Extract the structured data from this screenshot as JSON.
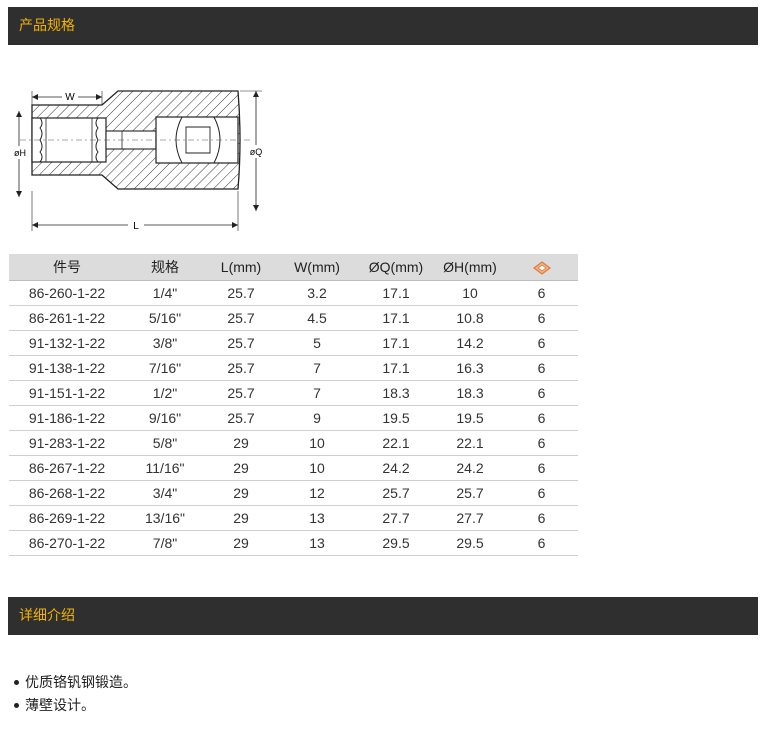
{
  "sections": {
    "specs_title": "产品规格",
    "details_title": "详细介绍"
  },
  "diagram": {
    "label_w": "W",
    "label_h": "øH",
    "label_q": "øQ",
    "label_l": "L"
  },
  "table": {
    "headers": [
      "件号",
      "规格",
      "L(mm)",
      "W(mm)",
      "ØQ(mm)",
      "ØH(mm)"
    ],
    "last_header_icon": "point-count-icon",
    "rows": [
      [
        "86-260-1-22",
        "1/4\"",
        "25.7",
        "3.2",
        "17.1",
        "10",
        "6"
      ],
      [
        "86-261-1-22",
        "5/16\"",
        "25.7",
        "4.5",
        "17.1",
        "10.8",
        "6"
      ],
      [
        "91-132-1-22",
        "3/8\"",
        "25.7",
        "5",
        "17.1",
        "14.2",
        "6"
      ],
      [
        "91-138-1-22",
        "7/16\"",
        "25.7",
        "7",
        "17.1",
        "16.3",
        "6"
      ],
      [
        "91-151-1-22",
        "1/2\"",
        "25.7",
        "7",
        "18.3",
        "18.3",
        "6"
      ],
      [
        "91-186-1-22",
        "9/16\"",
        "25.7",
        "9",
        "19.5",
        "19.5",
        "6"
      ],
      [
        "91-283-1-22",
        "5/8\"",
        "29",
        "10",
        "22.1",
        "22.1",
        "6"
      ],
      [
        "86-267-1-22",
        "11/16\"",
        "29",
        "10",
        "24.2",
        "24.2",
        "6"
      ],
      [
        "86-268-1-22",
        "3/4\"",
        "29",
        "12",
        "25.7",
        "25.7",
        "6"
      ],
      [
        "86-269-1-22",
        "13/16\"",
        "29",
        "13",
        "27.7",
        "27.7",
        "6"
      ],
      [
        "86-270-1-22",
        "7/8\"",
        "29",
        "13",
        "29.5",
        "29.5",
        "6"
      ]
    ]
  },
  "features": [
    "优质铬钒钢锻造。",
    "薄壁设计。"
  ],
  "colors": {
    "bar_bg": "#2f2f2f",
    "bar_text": "#f2b200",
    "header_bg": "#dcdcdc",
    "icon": "#e07a3a"
  }
}
